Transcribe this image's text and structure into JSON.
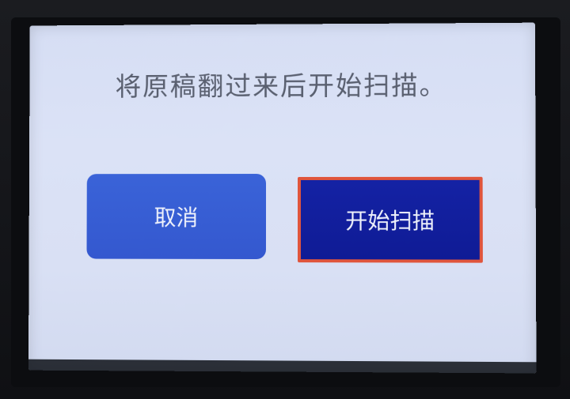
{
  "dialog": {
    "message": "将原稿翻过来后开始扫描。",
    "cancel_label": "取消",
    "start_label": "开始扫描"
  },
  "colors": {
    "screen_bg": "#d9e0f4",
    "cancel_button": "#3a63d8",
    "start_button": "#1422a4",
    "focus_border": "#e0553c",
    "message_text": "#5a6070"
  }
}
